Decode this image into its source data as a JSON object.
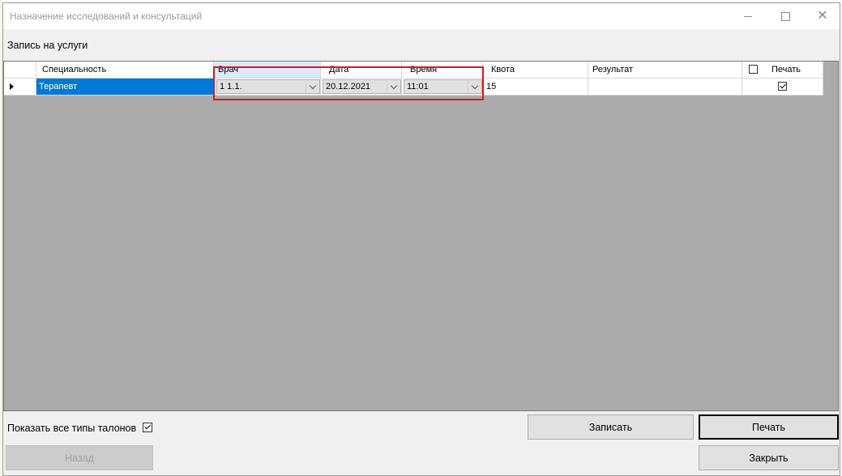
{
  "window": {
    "title": "Назначение исследований и консультаций",
    "controls": {
      "minimize": "minimize-icon",
      "maximize": "maximize-icon",
      "close": "close-icon"
    }
  },
  "section_label": "Запись на услуги",
  "grid": {
    "columns": [
      "Специальность",
      "Врач",
      "Дата",
      "Время",
      "Квота",
      "Результат",
      "Печать"
    ],
    "rows": [
      {
        "specialty": "Терапевт",
        "doctor": "1 1.1.",
        "date": "20.12.2021",
        "time": "11:01",
        "quota": "15",
        "result": "",
        "print_checked": true
      }
    ],
    "header_print_checked": false,
    "selection_color": "#0078d7",
    "highlight_color": "#e81123"
  },
  "footer": {
    "show_all_label": "Показать все типы талонов",
    "show_all_checked": true,
    "buttons": {
      "register": "Записать",
      "print": "Печать",
      "back": "Назад",
      "close": "Закрыть"
    }
  }
}
